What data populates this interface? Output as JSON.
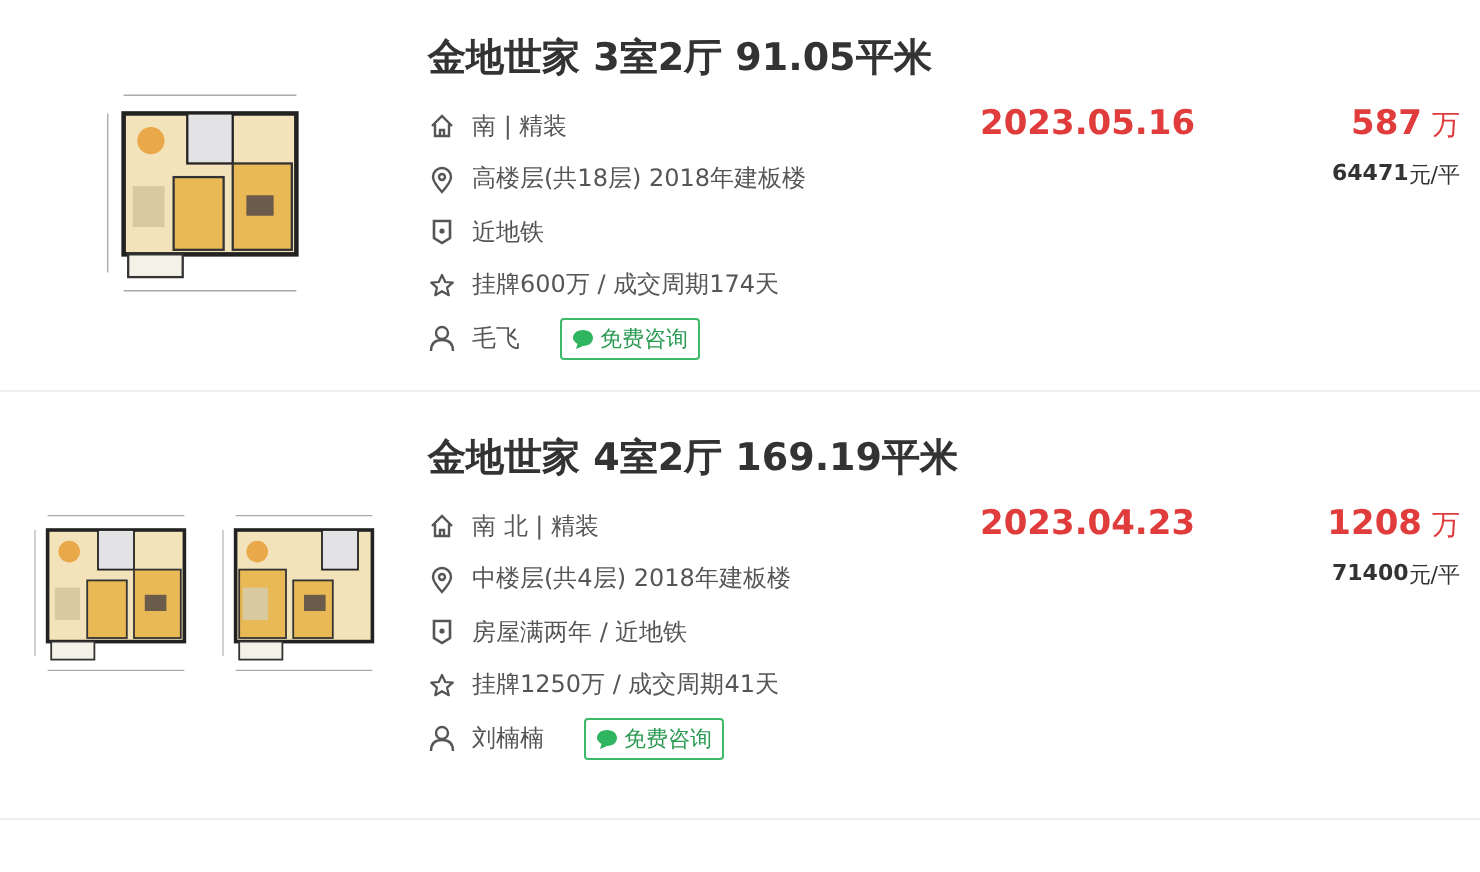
{
  "listings": [
    {
      "title": "金地世家 3室2厅 91.05平米",
      "features": [
        {
          "kind": "orientation",
          "text": "南 | 精装"
        },
        {
          "kind": "floor",
          "text": "高楼层(共18层) 2018年建板楼"
        },
        {
          "kind": "tag",
          "text": "近地铁"
        },
        {
          "kind": "listing",
          "text": "挂牌600万 / 成交周期174天"
        }
      ],
      "agent": "毛飞",
      "consult_button": "免费咨询",
      "date": "2023.05.16",
      "price": "587",
      "price_unit": "万",
      "unit_price": "64471",
      "unit_price_unit": "元/平"
    },
    {
      "title": "金地世家 4室2厅 169.19平米",
      "features": [
        {
          "kind": "orientation",
          "text": "南 北 | 精装"
        },
        {
          "kind": "floor",
          "text": "中楼层(共4层) 2018年建板楼"
        },
        {
          "kind": "tag",
          "text": "房屋满两年 / 近地铁"
        },
        {
          "kind": "listing",
          "text": "挂牌1250万 / 成交周期41天"
        }
      ],
      "agent": "刘楠楠",
      "consult_button": "免费咨询",
      "date": "2023.04.23",
      "price": "1208",
      "price_unit": "万",
      "unit_price": "71400",
      "unit_price_unit": "元/平"
    }
  ]
}
